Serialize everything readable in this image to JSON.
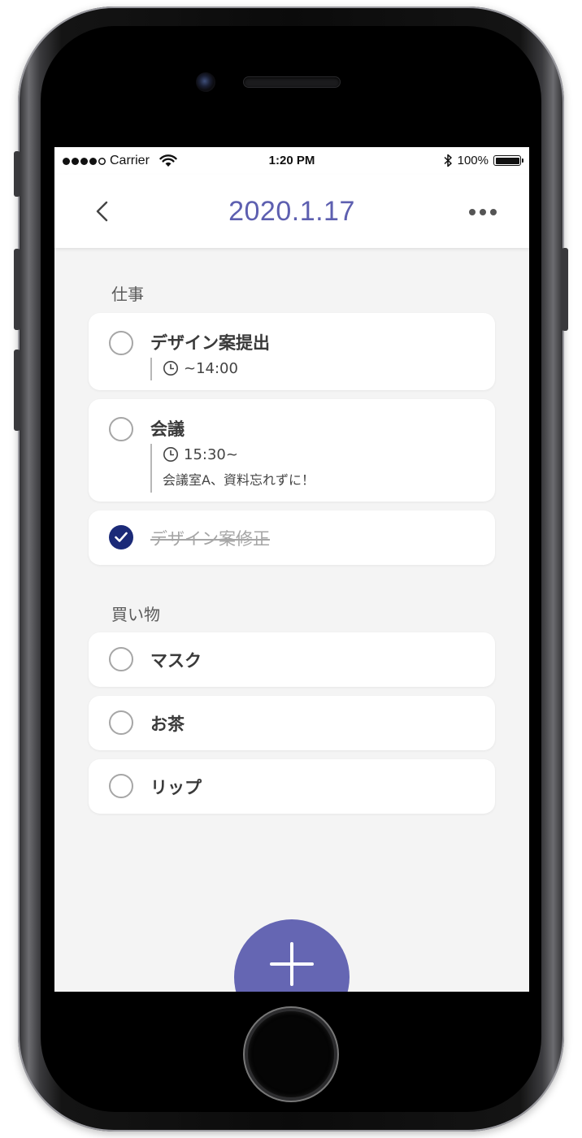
{
  "status_bar": {
    "carrier": "Carrier",
    "time": "1:20 PM",
    "battery": "100%",
    "battery_level": 1.0
  },
  "nav": {
    "title": "2020.1.17",
    "back_icon": "chevron-left-icon",
    "more_icon": "more-horizontal-icon"
  },
  "sections": [
    {
      "label": "仕事",
      "tasks": [
        {
          "title": "デザイン案提出",
          "time": "~14:00",
          "done": false
        },
        {
          "title": "会議",
          "time": "15:30~",
          "note": "会議室A、資料忘れずに！",
          "done": false
        },
        {
          "title": "デザイン案修正",
          "done": true
        }
      ]
    },
    {
      "label": "買い物",
      "tasks": [
        {
          "title": "マスク",
          "done": false
        },
        {
          "title": "お茶",
          "done": false
        },
        {
          "title": "リップ",
          "done": false
        }
      ]
    }
  ],
  "fab": {
    "icon": "plus-icon"
  },
  "colors": {
    "accent": "#5d5fb0",
    "fab": "#6566b3",
    "checked": "#1b2a78",
    "background": "#f4f4f4"
  }
}
